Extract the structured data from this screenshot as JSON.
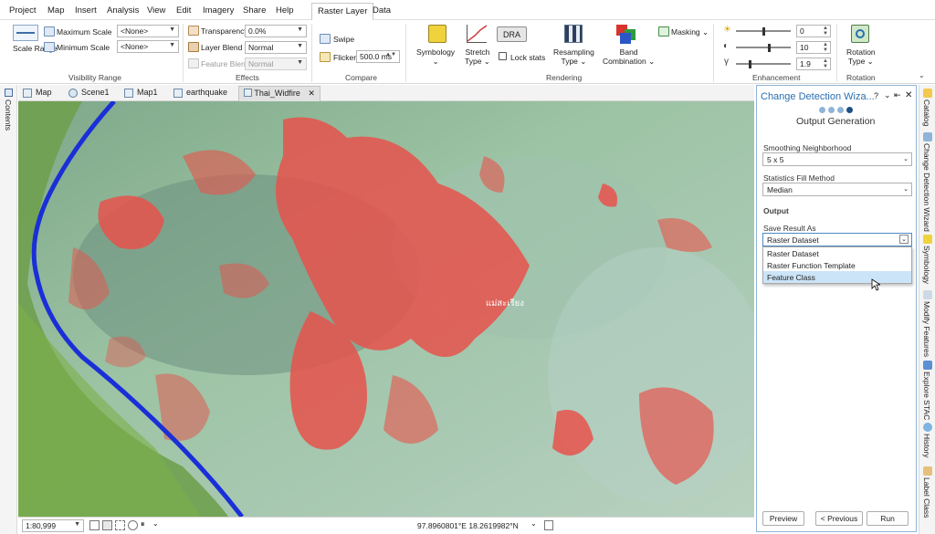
{
  "menu": {
    "items": [
      "Project",
      "Map",
      "Insert",
      "Analysis",
      "View",
      "Edit",
      "Imagery",
      "Share",
      "Help"
    ],
    "active_tab": "Raster Layer",
    "extra_tab": "Data"
  },
  "ribbon": {
    "visibility": {
      "scale_range": "Scale Range",
      "max_scale_label": "Maximum Scale",
      "max_scale_value": "<None>",
      "min_scale_label": "Minimum Scale",
      "min_scale_value": "<None>",
      "group": "Visibility Range"
    },
    "effects": {
      "transparency_label": "Transparency",
      "transparency_value": "0.0%",
      "layer_blend_label": "Layer Blend",
      "layer_blend_value": "Normal",
      "feature_blend_label": "Feature Blend",
      "feature_blend_value": "Normal",
      "group": "Effects"
    },
    "compare": {
      "swipe": "Swipe",
      "flicker": "Flicker",
      "flicker_value": "500.0",
      "flicker_unit": "ms",
      "group": "Compare"
    },
    "rendering": {
      "symbology": "Symbology",
      "stretch_type_1": "Stretch",
      "stretch_type_2": "Type",
      "dra": "DRA",
      "lock_stats": "Lock stats",
      "resampling_1": "Resampling",
      "resampling_2": "Type",
      "band_1": "Band",
      "band_2": "Combination",
      "masking": "Masking",
      "group": "Rendering"
    },
    "enhancement": {
      "brightness": "0",
      "contrast": "10",
      "gamma": "1.9",
      "group": "Enhancement"
    },
    "rotation": {
      "label_1": "Rotation",
      "label_2": "Type",
      "group": "Rotation"
    }
  },
  "left_strip": {
    "label": "Contents"
  },
  "view_tabs": [
    "Map",
    "Scene1",
    "Map1",
    "earthquake",
    "Thai_Widfire"
  ],
  "map": {
    "place_label": "แม่สะเรียง"
  },
  "status": {
    "scale": "1:80,999",
    "coordinates": "97.8960801°E 18.2619982°N"
  },
  "pane": {
    "title": "Change Detection Wiza...",
    "title_controls": "?",
    "step_title": "Output Generation",
    "smoothing_label": "Smoothing Neighborhood",
    "smoothing_value": "5 x 5",
    "stats_label": "Statistics Fill Method",
    "stats_value": "Median",
    "output_heading": "Output",
    "save_label": "Save Result As",
    "save_value": "Raster Dataset",
    "save_options": [
      "Raster Dataset",
      "Raster Function Template",
      "Feature Class"
    ],
    "preview": "Preview",
    "previous": "< Previous",
    "run": "Run"
  },
  "right_strip": [
    "Catalog",
    "Change Detection Wizard",
    "Symbology",
    "Modify Features",
    "Explore STAC",
    "History",
    "Label Class"
  ],
  "colors": {
    "accent": "#2a6fb0",
    "burn": "#e8524c",
    "river": "#1a2fd8",
    "highlight": "#cce4f7"
  }
}
